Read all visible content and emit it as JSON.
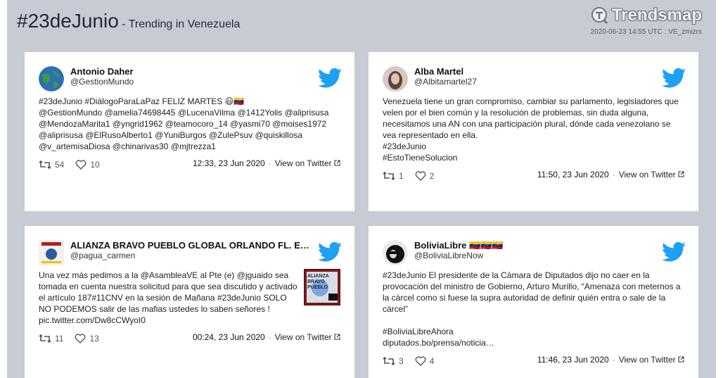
{
  "header": {
    "hashtag": "#23deJunio",
    "subtitle": " - Trending in Venezuela",
    "logo_text": "Trendsmap",
    "meta": "2020-06-23 14:55 UTC : VE_zmizrs"
  },
  "colors": {
    "twitter_blue": "#1da1f2",
    "frame": "#c7cbd3"
  },
  "tweets": [
    {
      "name": "Antonio Daher",
      "handle": "@GestionMundo",
      "lines": [
        "#23deJunio #DiálogoParaLaPaz FELIZ MARTES 😃🇻🇪",
        "@GestionMundo @amelia74698445 @LucenaVilma @1412Yolis @aliprisusa",
        "@MendozaMarita1 @yngrid1962 @teamocoro_14 @yasmi70 @moises1972",
        "@aliprisusa @ElRusoAlberto1 @YuniBurgos @ZulePsuv @quiskillosa",
        "@v_artemisaDiosa @chinarivas30 @mjtrezza1"
      ],
      "retweets": "54",
      "likes": "10",
      "time": "12:33, 23 Jun 2020",
      "view": "View on Twitter"
    },
    {
      "name": "Alba Martel",
      "handle": "@Albitamartel27",
      "lines": [
        "Venezuela tiene un gran compromiso, cambiar su parlamento, legisladores que",
        "velen por el bien común y la resolución de problemas, sin duda alguna,",
        "necesitamos una AN con una participación plural, dónde cada venezolano se",
        "vea representado en ella.",
        "#23deJunio",
        "#EstoTieneSolucion"
      ],
      "retweets": "1",
      "likes": "2",
      "time": "11:50, 23 Jun 2020",
      "view": "View on Twitter"
    },
    {
      "name": "ALIANZA BRAVO PUEBLO GLOBAL ORLANDO FL. EE…",
      "handle": "@pagua_carmen",
      "lines": [
        "Una vez más pedimos a la @AsambleaVE al Pte (e) @jguaido sea",
        "tomada en cuenta nuestra solicitud para que sea discutido y activado",
        "el artículo 187#11CNV en la sesión de Mañana #23deJunio SOLO",
        "NO PODEMOS salir de las mafias ustedes lo saben señores !",
        "pic.twitter.com/Dw8cCWyoI0"
      ],
      "retweets": "11",
      "likes": "13",
      "time": "00:24, 23 Jun 2020",
      "view": "View on Twitter",
      "thumb_text": "ALIANZA BRAVO PUEBLO GLOBAL"
    },
    {
      "name": "BoliviaLibre 🇻🇪🇻🇪🇻🇪",
      "handle": "@BoliviaLibreNow",
      "lines": [
        "#23deJunio El presidente de la Cámara de Diputados dijo no caer en la",
        "provocación del ministro de Gobierno, Arturo Murillo, “Amenaza con meternos a",
        "la cárcel como si fuese la supra autoridad de definir quién entra o sale de la",
        "cárcel”",
        "",
        "#BoliviaLibreAhora",
        "diputados.bo/prensa/noticia…"
      ],
      "retweets": "3",
      "likes": "4",
      "time": "11:46, 23 Jun 2020",
      "view": "View on Twitter"
    }
  ]
}
